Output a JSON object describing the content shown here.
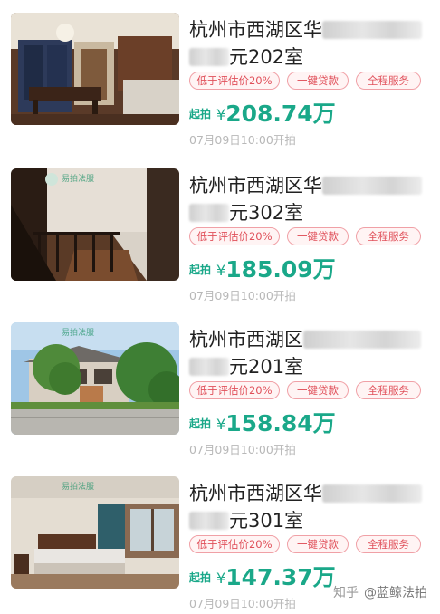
{
  "listings": [
    {
      "title_line1_visible": "杭州市西湖区华",
      "title_line2_visible": "元202室",
      "tags": [
        "低于评估价20%",
        "一键贷款",
        "全程服务"
      ],
      "price_label": "起拍",
      "currency": "¥",
      "price": "208.74万",
      "auction_time": "07月09日10:00开拍",
      "photo_kind": "dining-room"
    },
    {
      "title_line1_visible": "杭州市西湖区华",
      "title_line2_visible": "元302室",
      "tags": [
        "低于评估价20%",
        "一键贷款",
        "全程服务"
      ],
      "price_label": "起拍",
      "currency": "¥",
      "price": "185.09万",
      "auction_time": "07月09日10:00开拍",
      "photo_kind": "staircase",
      "watermark": "易拍法服"
    },
    {
      "title_line1_visible": "杭州市西湖区",
      "title_line2_visible": "元201室",
      "tags": [
        "低于评估价20%",
        "一键贷款",
        "全程服务"
      ],
      "price_label": "起拍",
      "currency": "¥",
      "price": "158.84万",
      "auction_time": "07月09日10:00开拍",
      "photo_kind": "villa-exterior",
      "watermark": "易拍法服"
    },
    {
      "title_line1_visible": "杭州市西湖区华",
      "title_line2_visible": "元301室",
      "tags": [
        "低于评估价20%",
        "一键贷款",
        "全程服务"
      ],
      "price_label": "起拍",
      "currency": "¥",
      "price": "147.37万",
      "auction_time": "07月09日10:00开拍",
      "photo_kind": "bedroom",
      "watermark": "易拍法服"
    }
  ],
  "credit": {
    "app": "知乎",
    "handle": "@蓝鲸法拍"
  },
  "colors": {
    "price_green": "#1aa889",
    "tag_red": "#e0505a",
    "time_gray": "#b8b8b8"
  }
}
